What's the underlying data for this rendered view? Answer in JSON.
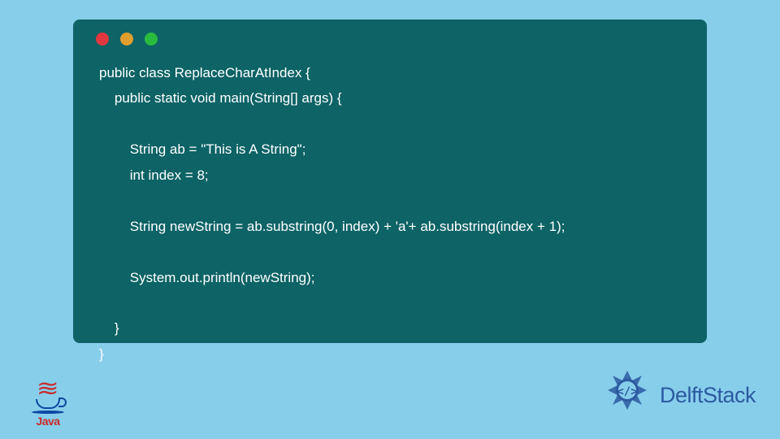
{
  "code": {
    "line1": "public class ReplaceCharAtIndex {",
    "line2": "    public static void main(String[] args) {",
    "line3": "",
    "line4": "        String ab = \"This is A String\";",
    "line5": "        int index = 8;",
    "line6": "",
    "line7": "        String newString = ab.substring(0, index) + 'a'+ ab.substring(index + 1);",
    "line8": "",
    "line9": "        System.out.println(newString);",
    "line10": "",
    "line11": "    }",
    "line12": "}"
  },
  "logos": {
    "java_text": "Java",
    "delft_text": "DelftStack"
  },
  "colors": {
    "background": "#87CEEB",
    "window": "#0d6366",
    "code_text": "#ffffff",
    "java_red": "#C92A2A",
    "java_blue": "#0D47A1",
    "delft_blue": "#2C5AA0"
  }
}
